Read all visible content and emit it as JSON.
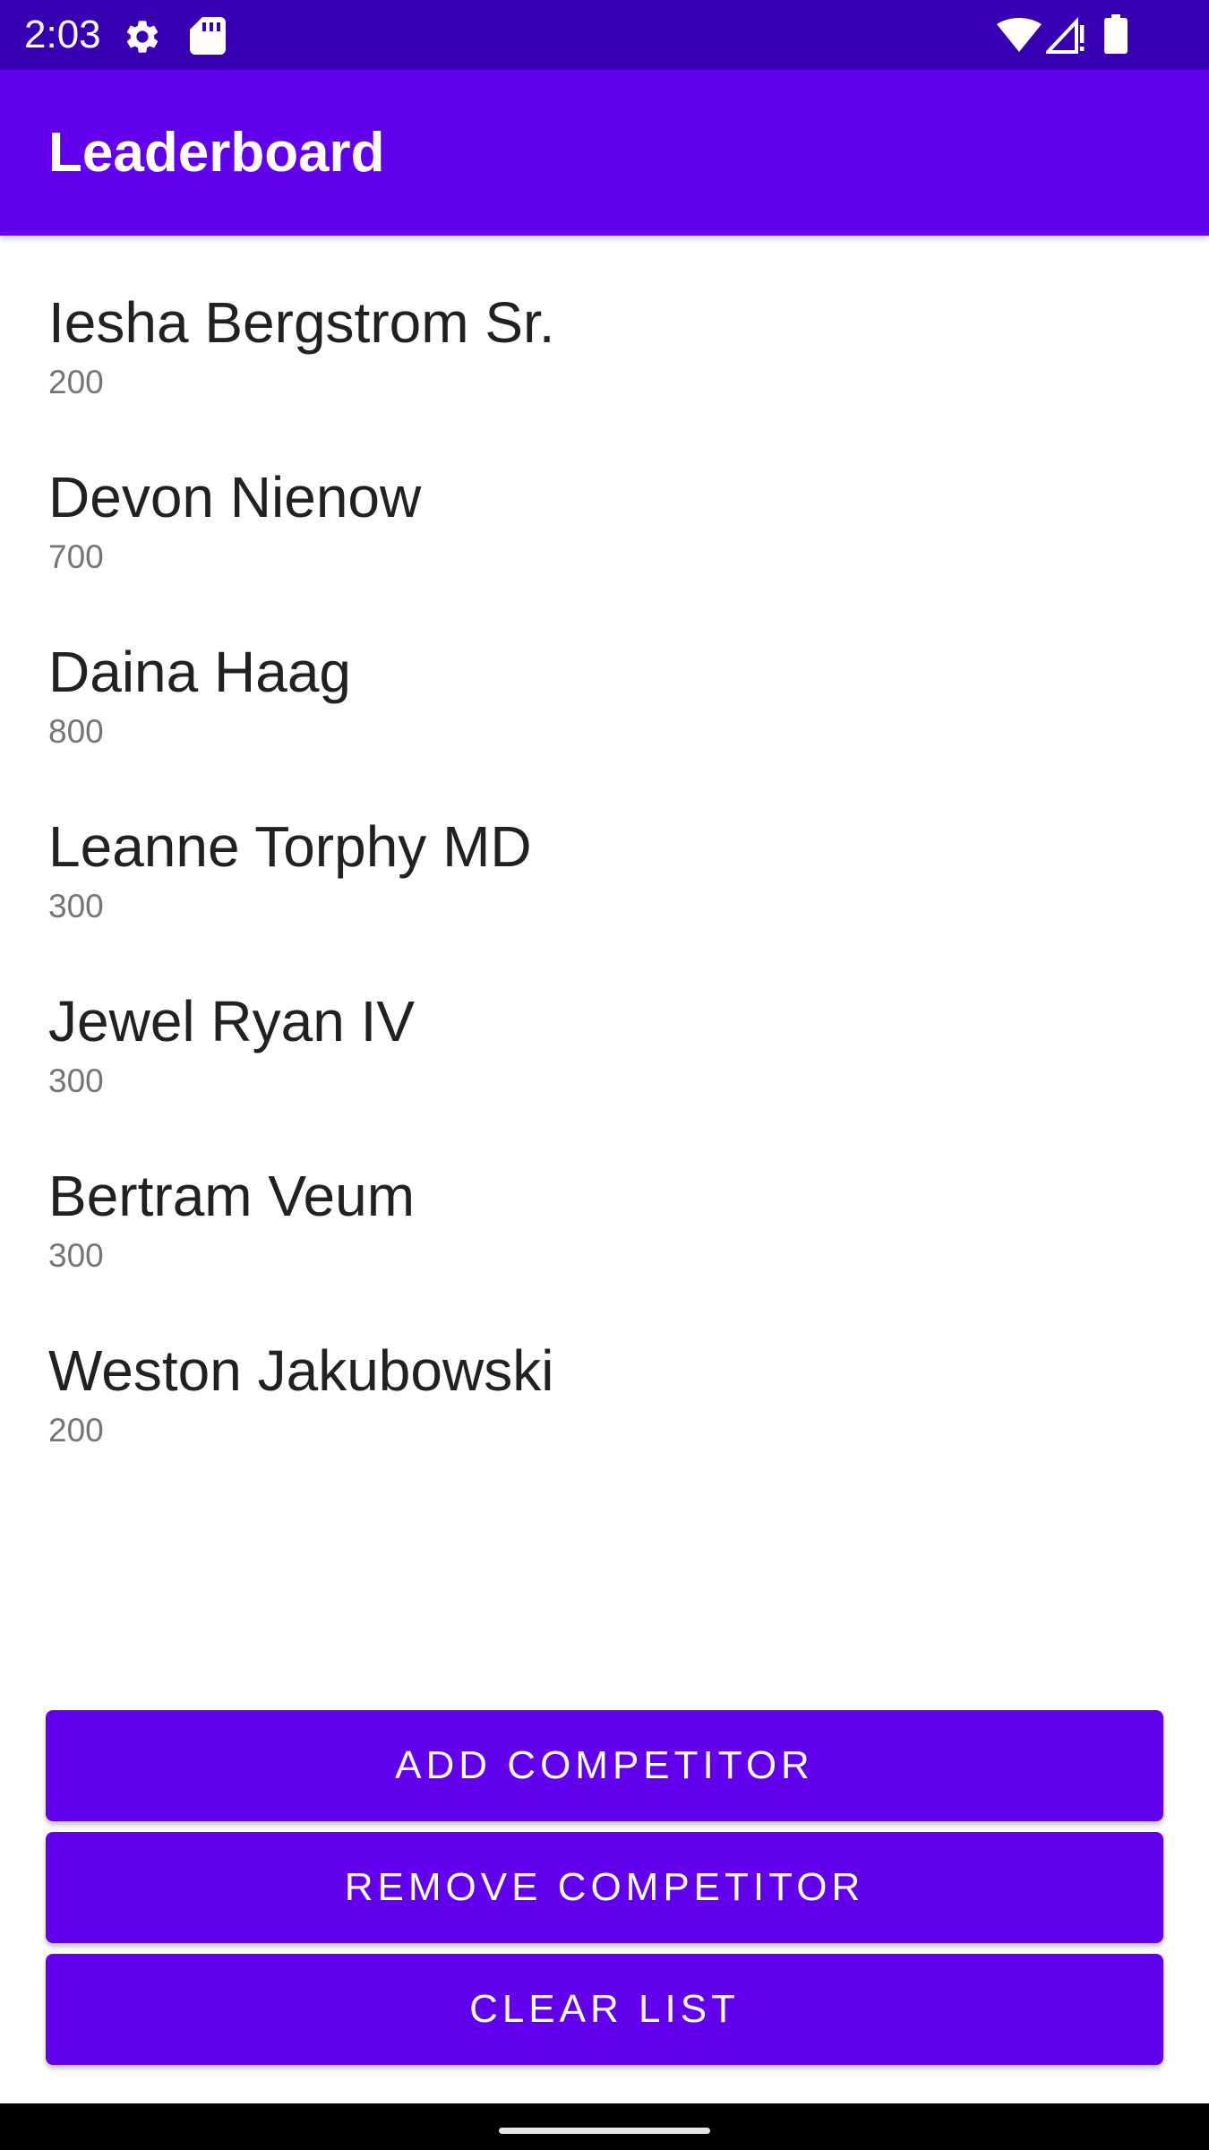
{
  "status_bar": {
    "time": "2:03",
    "left_icons": [
      "gear-icon",
      "sd-card-icon"
    ],
    "right_icons": [
      "wifi-icon",
      "cell-signal-icon",
      "battery-icon"
    ]
  },
  "app_bar": {
    "title": "Leaderboard"
  },
  "competitors": [
    {
      "name": "Iesha Bergstrom Sr.",
      "score": "200"
    },
    {
      "name": "Devon Nienow",
      "score": "700"
    },
    {
      "name": "Daina Haag",
      "score": "800"
    },
    {
      "name": "Leanne Torphy MD",
      "score": "300"
    },
    {
      "name": "Jewel Ryan IV",
      "score": "300"
    },
    {
      "name": "Bertram Veum",
      "score": "300"
    },
    {
      "name": "Weston Jakubowski",
      "score": "200"
    }
  ],
  "buttons": {
    "add_label": "ADD COMPETITOR",
    "remove_label": "REMOVE COMPETITOR",
    "clear_label": "CLEAR LIST"
  },
  "colors": {
    "status_bar": "#3700B3",
    "primary": "#6200EE",
    "text_primary": "#212121",
    "text_secondary": "#757575"
  }
}
